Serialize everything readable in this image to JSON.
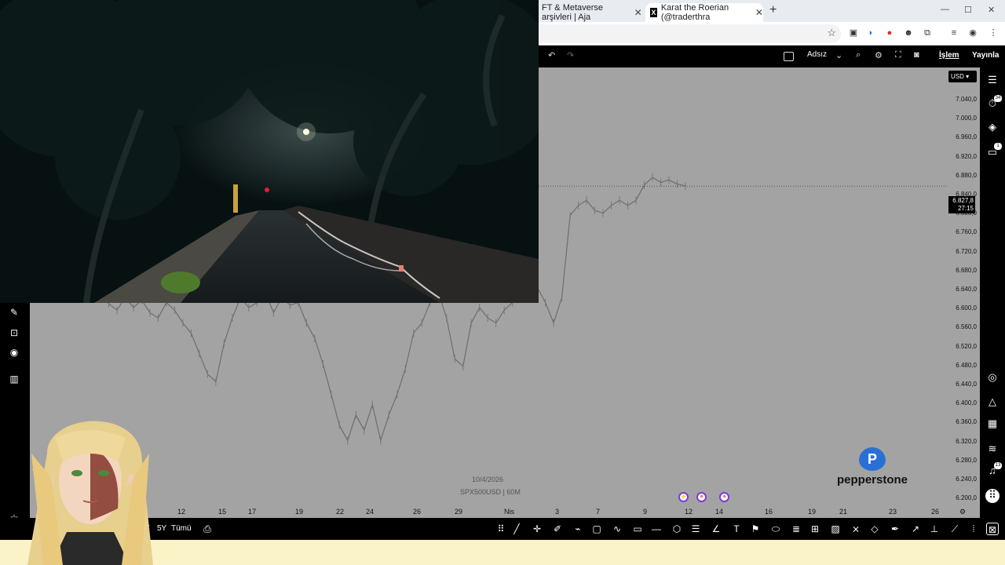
{
  "browser": {
    "tabs": [
      {
        "label": "FT & Metaverse arşivleri | Aja",
        "active": false
      },
      {
        "label": "Karat the Roerian (@traderthra",
        "active": true
      }
    ],
    "new_tab": "+",
    "window_controls": [
      "—",
      "☐",
      "✕"
    ],
    "bookmark_icon": "star-icon"
  },
  "tv_toolbar": {
    "undo_icon": "undo-icon",
    "redo_icon": "redo-icon",
    "layout_name": "Adsız",
    "islem_label": "İşlem",
    "publish_label": "Yayınla"
  },
  "chart": {
    "currency": "USD",
    "last_price": "6.827,8",
    "countdown": "27:15",
    "watermark_date": "10/4/2026",
    "watermark_symbol": "SPX500USD | 60M",
    "price_ticks": [
      "7.040,0",
      "7.000,0",
      "6.960,0",
      "6.920,0",
      "6.880,0",
      "6.840,0",
      "6.800,0",
      "6.760,0",
      "6.720,0",
      "6.680,0",
      "6.640,0",
      "6.600,0",
      "6.560,0",
      "6.520,0",
      "6.480,0",
      "6.440,0",
      "6.400,0",
      "6.360,0",
      "6.320,0",
      "6.280,0",
      "6.240,0",
      "6.200,0"
    ],
    "time_ticks": [
      "12",
      "15",
      "17",
      "19",
      "22",
      "24",
      "26",
      "29",
      "Nis",
      "3",
      "7",
      "9",
      "12",
      "14",
      "16",
      "19",
      "21",
      "23",
      "26"
    ],
    "brand": "pepperstone",
    "brand_mark": "P"
  },
  "chart_data": {
    "type": "line",
    "title": "",
    "symbol": "SPX500USD",
    "interval": "60M",
    "ylim": [
      6200,
      7060
    ],
    "x_ticks": [
      "12",
      "15",
      "17",
      "19",
      "22",
      "24",
      "26",
      "29",
      "Nis",
      "3",
      "7",
      "9",
      "12",
      "14",
      "16",
      "19",
      "21",
      "23",
      "26"
    ],
    "series": [
      {
        "values": [
          6620,
          6598,
          6585,
          6610,
          6590,
          6605,
          6580,
          6570,
          6600,
          6585,
          6560,
          6540,
          6500,
          6460,
          6445,
          6520,
          6570,
          6610,
          6590,
          6600,
          6620,
          6580,
          6610,
          6595,
          6600,
          6560,
          6530,
          6480,
          6420,
          6360,
          6330,
          6380,
          6350,
          6400,
          6330,
          6380,
          6420,
          6470,
          6540,
          6560,
          6600,
          6620,
          6570,
          6490,
          6475,
          6560,
          6590,
          6570,
          6560,
          6585,
          6600,
          6620,
          6610,
          6630,
          6600,
          6560,
          6610,
          6770,
          6790,
          6800,
          6780,
          6775,
          6790,
          6800,
          6790,
          6800,
          6830,
          6845,
          6835,
          6840,
          6832,
          6828
        ]
      }
    ],
    "current_price_line": 6827.8,
    "grid": false
  },
  "bottom_toolbar": {
    "ranges": [
      "Y",
      "5Y",
      "Tümü"
    ]
  },
  "right_sidebar": {
    "badge_alerts": "34",
    "badge_ideas": "1",
    "badge_notifications": "13"
  }
}
